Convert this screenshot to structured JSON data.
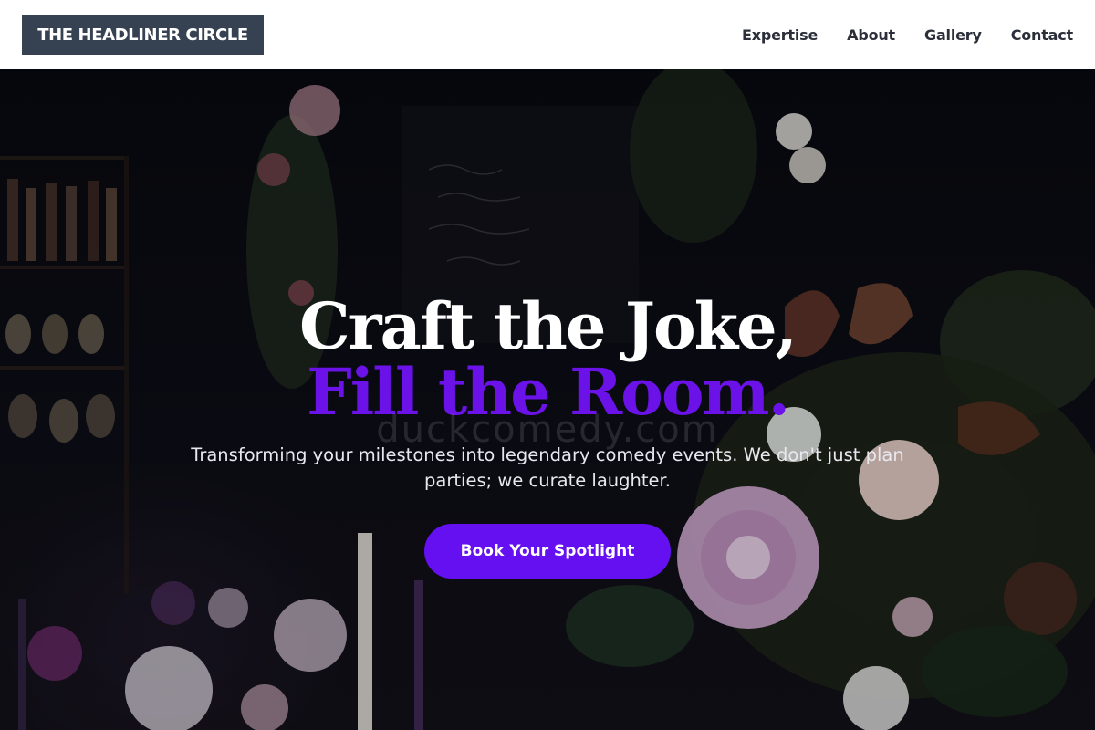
{
  "header": {
    "logo_text": "THE HEADLINER CIRCLE",
    "nav": [
      {
        "label": "Expertise"
      },
      {
        "label": "About"
      },
      {
        "label": "Gallery"
      },
      {
        "label": "Contact"
      }
    ]
  },
  "hero": {
    "headline_line1": "Craft the Joke,",
    "headline_line2": "Fill the Room.",
    "watermark": "duckcomedy.com",
    "tagline": "Transforming your milestones into legendary comedy events. We don't just plan parties; we curate laughter.",
    "cta_label": "Book Your Spotlight",
    "background_image": "dark floral bar scene"
  },
  "colors": {
    "accent": "#6410f0",
    "headline_accent": "#6a12e8",
    "logo_bg": "#364152",
    "nav_text": "#2a2f3a"
  }
}
